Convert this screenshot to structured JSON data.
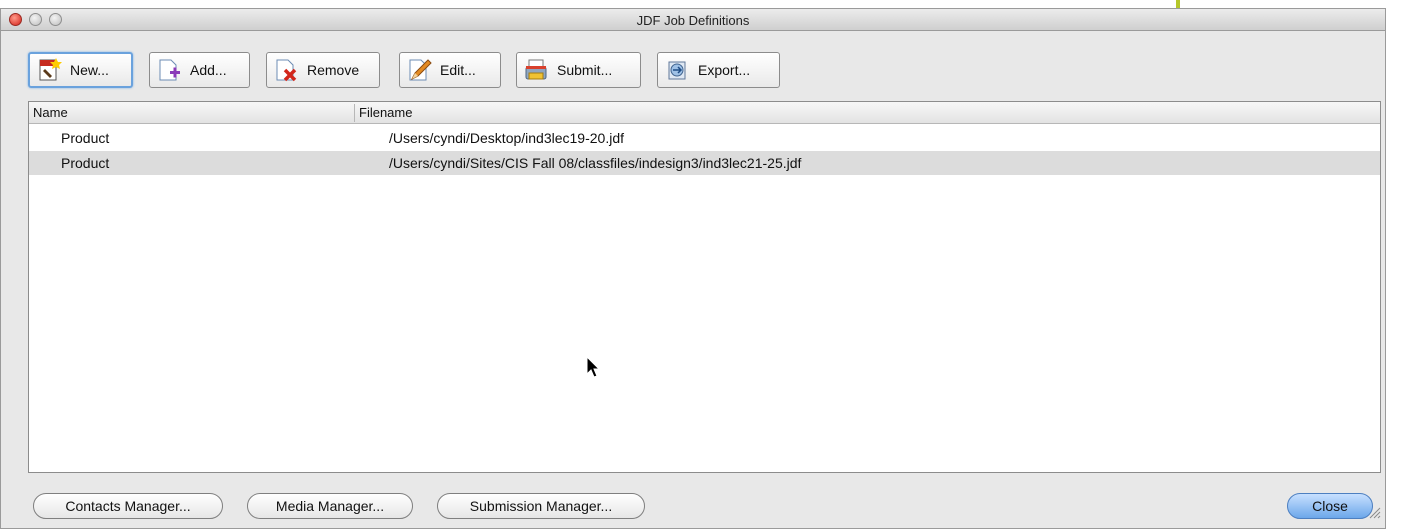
{
  "window": {
    "title": "JDF Job Definitions"
  },
  "toolbar": {
    "new_label": "New...",
    "add_label": "Add...",
    "remove_label": "Remove",
    "edit_label": "Edit...",
    "submit_label": "Submit...",
    "export_label": "Export..."
  },
  "table": {
    "columns": {
      "name": "Name",
      "filename": "Filename"
    },
    "rows": [
      {
        "name": "Product",
        "filename": "/Users/cyndi/Desktop/ind3lec19-20.jdf",
        "selected": false
      },
      {
        "name": "Product",
        "filename": "/Users/cyndi/Sites/CIS Fall 08/classfiles/indesign3/ind3lec21-25.jdf",
        "selected": true
      }
    ]
  },
  "bottom": {
    "contacts_label": "Contacts Manager...",
    "media_label": "Media Manager...",
    "submission_label": "Submission Manager...",
    "close_label": "Close"
  },
  "colors": {
    "accent": "#6aa2dd",
    "selection": "#dcdcdc",
    "close_button": "#6ca7ea"
  }
}
